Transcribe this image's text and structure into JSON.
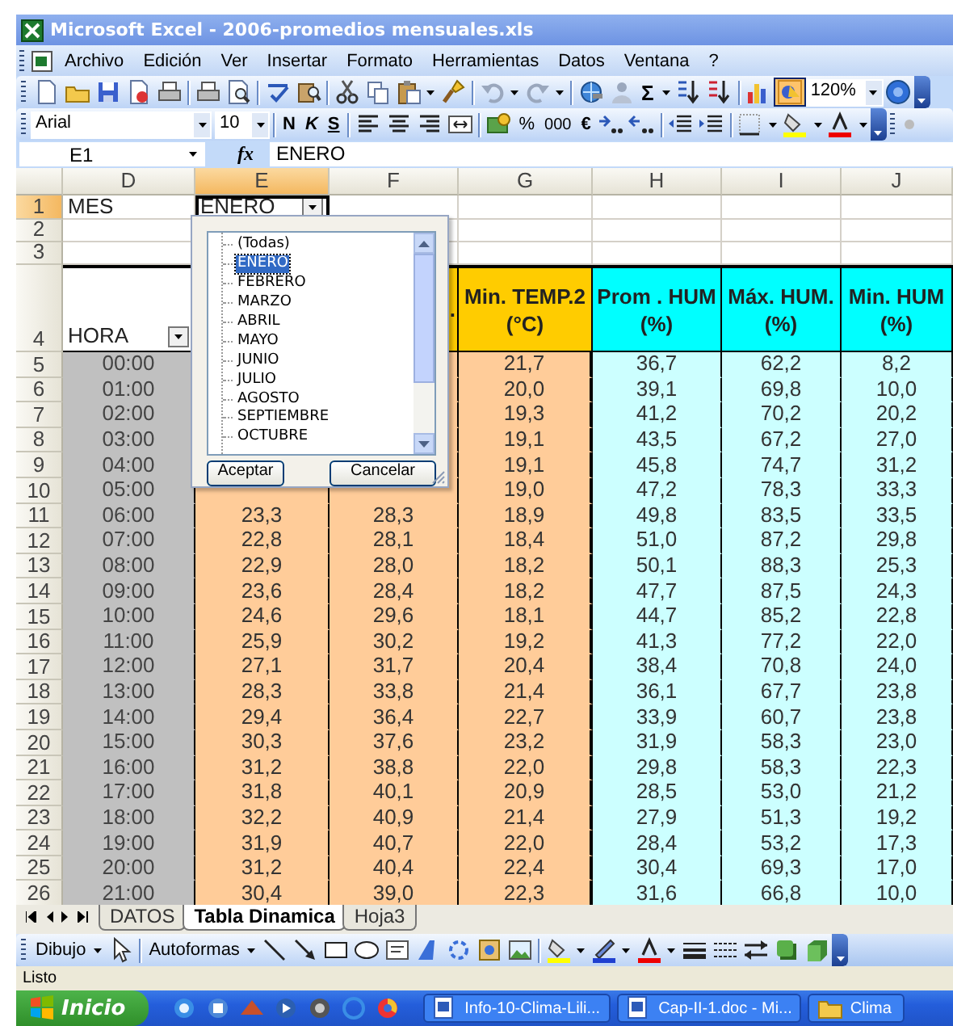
{
  "window": {
    "title": "Microsoft Excel - 2006-promedios mensuales.xls"
  },
  "menu": [
    {
      "label": "Archivo"
    },
    {
      "label": "Edición"
    },
    {
      "label": "Ver"
    },
    {
      "label": "Insertar"
    },
    {
      "label": "Formato"
    },
    {
      "label": "Herramientas"
    },
    {
      "label": "Datos"
    },
    {
      "label": "Ventana"
    },
    {
      "label": "?"
    }
  ],
  "standard_toolbar": {
    "sum": "Σ",
    "zoom": "120%"
  },
  "format_toolbar": {
    "font": "Arial",
    "size": "10",
    "bold": "N",
    "italic": "K",
    "underline": "S",
    "percent": "%",
    "thousands": "000",
    "currency": "€"
  },
  "formula_bar": {
    "cell": "E1",
    "function": "fx",
    "content": "ENERO"
  },
  "columns": [
    {
      "letter": "D",
      "selected": false,
      "color": "#c0c0c0"
    },
    {
      "letter": "E",
      "selected": true,
      "color": "#ffcc99"
    },
    {
      "letter": "F",
      "selected": false,
      "color": "#ffcc99"
    },
    {
      "letter": "G",
      "selected": false,
      "color": "#ffcc99"
    },
    {
      "letter": "H",
      "selected": false,
      "color": "#ccffff"
    },
    {
      "letter": "I",
      "selected": false,
      "color": "#ccffff"
    },
    {
      "letter": "J",
      "selected": false,
      "color": "#ccffff"
    }
  ],
  "rows": [
    {
      "number": "1",
      "selected": true,
      "kind": "filter",
      "cells": [
        "MES",
        "ENERO"
      ]
    },
    {
      "number": "2",
      "selected": false,
      "kind": "blank"
    },
    {
      "number": "3",
      "selected": false,
      "kind": "blank"
    },
    {
      "number": "4",
      "selected": false,
      "kind": "header",
      "cells": [
        {
          "lines": [
            "HORA"
          ]
        },
        null,
        {
          "lines": [
            "."
          ],
          "color": "#ffcc00"
        },
        {
          "lines": [
            "Min. TEMP.2",
            "(°C)"
          ],
          "color": "#ffcc00"
        },
        {
          "lines": [
            "Prom . HUM",
            "(%)"
          ],
          "color": "#00ffff"
        },
        {
          "lines": [
            "Máx. HUM.",
            "(%)"
          ],
          "color": "#00ffff"
        },
        {
          "lines": [
            "Min. HUM",
            "(%)"
          ],
          "color": "#00ffff"
        }
      ]
    },
    {
      "number": "5",
      "selected": false,
      "kind": "data",
      "cells": [
        "00:00",
        null,
        null,
        "21,7",
        "36,7",
        "62,2",
        "8,2"
      ]
    },
    {
      "number": "6",
      "selected": false,
      "kind": "data",
      "cells": [
        "01:00",
        null,
        null,
        "20,0",
        "39,1",
        "69,8",
        "10,0"
      ]
    },
    {
      "number": "7",
      "selected": false,
      "kind": "data",
      "cells": [
        "02:00",
        null,
        null,
        "19,3",
        "41,2",
        "70,2",
        "20,2"
      ]
    },
    {
      "number": "8",
      "selected": false,
      "kind": "data",
      "cells": [
        "03:00",
        null,
        null,
        "19,1",
        "43,5",
        "67,2",
        "27,0"
      ]
    },
    {
      "number": "9",
      "selected": false,
      "kind": "data",
      "cells": [
        "04:00",
        null,
        null,
        "19,1",
        "45,8",
        "74,7",
        "31,2"
      ]
    },
    {
      "number": "10",
      "selected": false,
      "kind": "data",
      "cells": [
        "05:00",
        null,
        null,
        "19,0",
        "47,2",
        "78,3",
        "33,3"
      ]
    },
    {
      "number": "11",
      "selected": false,
      "kind": "data",
      "cells": [
        "06:00",
        "23,3",
        "28,3",
        "18,9",
        "49,8",
        "83,5",
        "33,5"
      ]
    },
    {
      "number": "12",
      "selected": false,
      "kind": "data",
      "cells": [
        "07:00",
        "22,8",
        "28,1",
        "18,4",
        "51,0",
        "87,2",
        "29,8"
      ]
    },
    {
      "number": "13",
      "selected": false,
      "kind": "data",
      "cells": [
        "08:00",
        "22,9",
        "28,0",
        "18,2",
        "50,1",
        "88,3",
        "25,3"
      ]
    },
    {
      "number": "14",
      "selected": false,
      "kind": "data",
      "cells": [
        "09:00",
        "23,6",
        "28,4",
        "18,2",
        "47,7",
        "87,5",
        "24,3"
      ]
    },
    {
      "number": "15",
      "selected": false,
      "kind": "data",
      "cells": [
        "10:00",
        "24,6",
        "29,6",
        "18,1",
        "44,7",
        "85,2",
        "22,8"
      ]
    },
    {
      "number": "16",
      "selected": false,
      "kind": "data",
      "cells": [
        "11:00",
        "25,9",
        "30,2",
        "19,2",
        "41,3",
        "77,2",
        "22,0"
      ]
    },
    {
      "number": "17",
      "selected": false,
      "kind": "data",
      "cells": [
        "12:00",
        "27,1",
        "31,7",
        "20,4",
        "38,4",
        "70,8",
        "24,0"
      ]
    },
    {
      "number": "18",
      "selected": false,
      "kind": "data",
      "cells": [
        "13:00",
        "28,3",
        "33,8",
        "21,4",
        "36,1",
        "67,7",
        "23,8"
      ]
    },
    {
      "number": "19",
      "selected": false,
      "kind": "data",
      "cells": [
        "14:00",
        "29,4",
        "36,4",
        "22,7",
        "33,9",
        "60,7",
        "23,8"
      ]
    },
    {
      "number": "20",
      "selected": false,
      "kind": "data",
      "cells": [
        "15:00",
        "30,3",
        "37,6",
        "23,2",
        "31,9",
        "58,3",
        "23,0"
      ]
    },
    {
      "number": "21",
      "selected": false,
      "kind": "data",
      "cells": [
        "16:00",
        "31,2",
        "38,8",
        "22,0",
        "29,8",
        "58,3",
        "22,3"
      ]
    },
    {
      "number": "22",
      "selected": false,
      "kind": "data",
      "cells": [
        "17:00",
        "31,8",
        "40,1",
        "20,9",
        "28,5",
        "53,0",
        "21,2"
      ]
    },
    {
      "number": "23",
      "selected": false,
      "kind": "data",
      "cells": [
        "18:00",
        "32,2",
        "40,9",
        "21,4",
        "27,9",
        "51,3",
        "19,2"
      ]
    },
    {
      "number": "24",
      "selected": false,
      "kind": "data",
      "cells": [
        "19:00",
        "31,9",
        "40,7",
        "22,0",
        "28,4",
        "53,2",
        "17,3"
      ]
    },
    {
      "number": "25",
      "selected": false,
      "kind": "data",
      "cells": [
        "20:00",
        "31,2",
        "40,4",
        "22,4",
        "30,4",
        "69,3",
        "17,0"
      ]
    },
    {
      "number": "26",
      "selected": false,
      "kind": "data",
      "cells": [
        "21:00",
        "30,4",
        "39,0",
        "22,3",
        "31,6",
        "66,8",
        "10,0"
      ]
    }
  ],
  "filter_popup": {
    "items": [
      {
        "label": "(Todas)",
        "selected": false
      },
      {
        "label": "ENERO",
        "selected": true
      },
      {
        "label": "FEBRERO",
        "selected": false
      },
      {
        "label": "MARZO",
        "selected": false
      },
      {
        "label": "ABRIL",
        "selected": false
      },
      {
        "label": "MAYO",
        "selected": false
      },
      {
        "label": "JUNIO",
        "selected": false
      },
      {
        "label": "JULIO",
        "selected": false
      },
      {
        "label": "AGOSTO",
        "selected": false
      },
      {
        "label": "SEPTIEMBRE",
        "selected": false
      },
      {
        "label": "OCTUBRE",
        "selected": false
      }
    ],
    "buttons": [
      "Aceptar",
      "Cancelar"
    ]
  },
  "sheet_tabs": [
    {
      "label": "DATOS",
      "selected": false
    },
    {
      "label": "Tabla Dinamica",
      "selected": true
    },
    {
      "label": "Hoja3",
      "selected": false
    }
  ],
  "drawing_toolbar": {
    "draw_menu": "Dibujo",
    "autoshapes_menu": "Autoformas"
  },
  "status_bar": {
    "text": "Listo"
  },
  "taskbar": {
    "start": "Inicio",
    "tasks": [
      {
        "label": "Info-10-Clima-Lili...",
        "kind": "document"
      },
      {
        "label": "Cap-II-1.doc - Mi...",
        "kind": "document"
      },
      {
        "label": "Clima",
        "kind": "folder"
      }
    ]
  }
}
